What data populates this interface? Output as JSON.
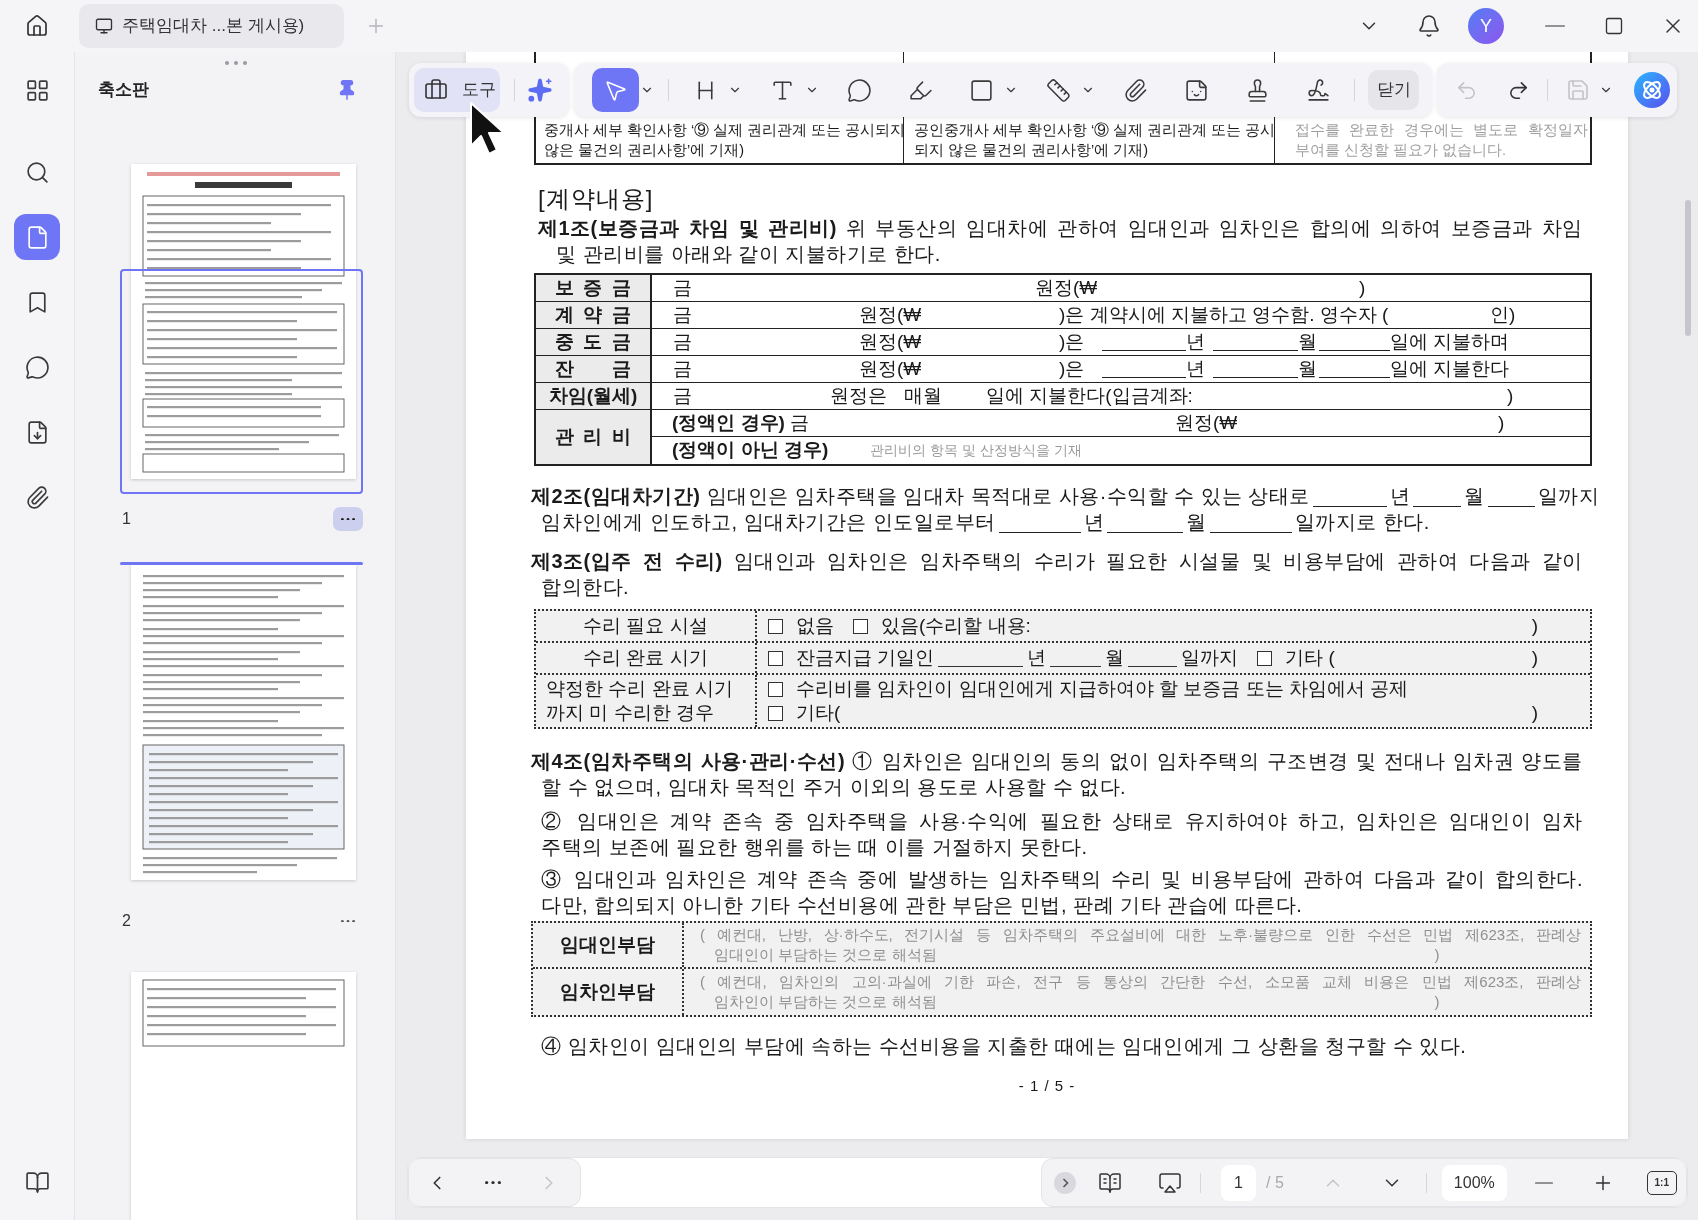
{
  "tab_bar": {
    "tabs": [
      {
        "title": "주택임대차 ...본 게시용)",
        "selected": true
      }
    ],
    "avatar": "Y"
  },
  "sidebar": {
    "items": [
      {
        "selected": false
      },
      {
        "selected": false
      },
      {
        "selected": true
      },
      {
        "selected": false
      },
      {
        "selected": false
      },
      {
        "selected": false
      },
      {
        "selected": false
      }
    ]
  },
  "thumbnails": {
    "title": "축소판",
    "pinned": true,
    "pages": [
      {
        "label": "1",
        "in_view": true,
        "menu_hovered": true
      },
      {
        "label": "2",
        "in_view": true,
        "menu_hovered": false
      }
    ],
    "more_below": true
  },
  "toolbar": {
    "mode_button": {
      "label": "도구",
      "selected": true
    },
    "tools": [
      {
        "selected": true,
        "dropdown": true
      },
      {
        "selected": false,
        "dropdown": true
      },
      {
        "selected": false,
        "dropdown": true
      },
      {
        "selected": false,
        "dropdown": false
      },
      {
        "selected": false,
        "dropdown": false
      },
      {
        "selected": false,
        "dropdown": true
      },
      {
        "selected": false,
        "dropdown": true
      },
      {
        "selected": false,
        "dropdown": false
      },
      {
        "selected": false,
        "dropdown": false
      },
      {
        "selected": false,
        "dropdown": false
      },
      {
        "selected": false,
        "dropdown": false
      }
    ],
    "close_button": "닫기",
    "undo_disabled": true,
    "redo_disabled": false,
    "save_disabled": true
  },
  "document": {
    "blocks": [
      {
        "kind": "fragment_table",
        "columns": [
          {
            "muted": false,
            "lines": [
              "중개사 세부 확인사항 ‘⑨ 실제 권리관계 또는 공시되지",
              "않은 물건의 권리사항’에 기재)"
            ]
          },
          {
            "muted": false,
            "lines": [
              "공인중개사 세부 확인사항 ‘⑨ 실제 권리관계 또는 공시",
              "되지 않은 물건의 권리사항’에 기재)"
            ]
          },
          {
            "muted": true,
            "lines": [
              "접수를 완료한 경우에는 별도로 확정일자",
              "부여를 신청할 필요가 없습니다."
            ]
          }
        ]
      },
      {
        "kind": "heading",
        "text": "[계약내용]"
      },
      {
        "kind": "article",
        "lines": [
          "**제1조(보증금과 차임 및 관리비)** 위 부동산의 임대차에 관하여 임대인과 임차인은 합의에 의하여 보증금과 차임",
          "및 관리비를 아래와 같이 지불하기로 한다."
        ]
      },
      {
        "kind": "payment_table",
        "rows": [
          {
            "label": "보 증 금",
            "kind": "amount",
            "parts": [
              "금",
              "원정(₩",
              ")"
            ]
          },
          {
            "label": "계 약 금",
            "kind": "receipt",
            "parts": [
              "금",
              "원정(₩",
              ")은 계약시에 지불하고 영수함. 영수자 (",
              "인)"
            ]
          },
          {
            "label": "중 도 금",
            "kind": "schedule",
            "parts": [
              "금",
              "원정(₩",
              ")은",
              "년",
              "월",
              "일에 지불하며"
            ]
          },
          {
            "label": "잔 금",
            "kind": "schedule",
            "parts": [
              "금",
              "원정(₩",
              ")은",
              "년",
              "월",
              "일에 지불한다"
            ]
          },
          {
            "label": "차임(월세)",
            "kind": "rent",
            "parts": [
              "금",
              "원정은",
              "매월",
              "일에 지불한다(입금계좌:",
              ")"
            ]
          },
          {
            "label": "관 리 비",
            "kind": "fee",
            "subrows": [
              {
                "kind": "fixed",
                "parts": [
                  "**(정액인 경우)** 금",
                  "원정(₩",
                  ")"
                ]
              },
              {
                "kind": "variable",
                "parts": [
                  "(정액이 아닌 경우)",
                  "관리비의 항목 및 산정방식을 기재"
                ]
              }
            ]
          }
        ]
      },
      {
        "kind": "article",
        "lines": [
          [
            "**제2조(임대차기간)** 임대인은 임차주택을 임대차 목적대로 사용·수익할 수 있는 상태로",
            "년",
            "월",
            "일까지"
          ],
          [
            "임차인에게 인도하고, 임대차기간은 인도일로부터",
            "년",
            "월",
            "일까지로 한다."
          ]
        ]
      },
      {
        "kind": "article",
        "lines": [
          "**제3조(입주 전 수리)** 임대인과 임차인은 임차주택의 수리가 필요한 시설물 및 비용부담에 관하여 다음과 같이",
          "합의한다."
        ]
      },
      {
        "kind": "repair_table",
        "rows": [
          {
            "label": "수리 필요 시설",
            "kind": "inline",
            "options": [
              {
                "checked": false,
                "parts": [
                  "없음"
                ]
              },
              {
                "checked": false,
                "parts": [
                  "있음(수리할 내용:"
                ]
              }
            ],
            "end": ")"
          },
          {
            "label": "수리 완료 시기",
            "kind": "inline",
            "options": [
              {
                "checked": false,
                "parts": [
                  "잔금지급 기일인",
                  "년",
                  "월",
                  "일까지"
                ]
              },
              {
                "checked": false,
                "parts": [
                  "기타 ("
                ]
              }
            ],
            "end": ")"
          },
          {
            "label": "약정한 수리 완료 시기 까지 미 수리한 경우",
            "kind": "stacked",
            "options": [
              {
                "checked": false,
                "parts": [
                  "수리비를 임차인이 임대인에게 지급하여야 할 보증금 또는 차임에서 공제"
                ]
              },
              {
                "checked": false,
                "parts": [
                  "기타("
                ]
              }
            ],
            "end": ")"
          }
        ]
      },
      {
        "kind": "article",
        "lines": [
          "**제4조(임차주택의 사용·관리·수선)** ① 임차인은 임대인의 동의 없이 임차주택의 구조변경 및 전대나 임차권 양도를",
          "할 수 없으며, 임대차 목적인 주거 이외의 용도로 사용할 수 없다."
        ]
      },
      {
        "kind": "clause",
        "lines": [
          "② 임대인은 계약 존속 중 임차주택을 사용·수익에 필요한 상태로 유지하여야 하고, 임차인은 임대인이 임차",
          "주택의 보존에 필요한 행위를 하는 때 이를 거절하지 못한다."
        ]
      },
      {
        "kind": "clause",
        "lines": [
          "③ 임대인과 임차인은 계약 존속 중에 발생하는 임차주택의 수리 및 비용부담에 관하여 다음과 같이 합의한다.",
          "다만, 합의되지 아니한 기타 수선비용에 관한 부담은 민법, 판례 기타 관습에 따른다."
        ]
      },
      {
        "kind": "burden_table",
        "rows": [
          {
            "label": "임대인부담",
            "lines": [
              "( 예컨대, 난방, 상·하수도, 전기시설 등 임차주택의 주요설비에 대한 노후·불량으로 인한 수선은 민법 제623조, 판례상",
              "임대인이 부담하는 것으로 해석됨"
            ],
            "end": ")"
          },
          {
            "label": "임차인부담",
            "lines": [
              "( 예컨대, 임차인의 고의·과실에 기한 파손, 전구 등 통상의 간단한 수선, 소모품 교체 비용은 민법 제623조, 판례상",
              "임차인이 부담하는 것으로 해석됨"
            ],
            "end": ")"
          }
        ]
      },
      {
        "kind": "clause",
        "lines": [
          "④ 임차인이 임대인의 부담에 속하는 수선비용을 지출한 때에는 임대인에게 그 상환을 청구할 수 있다."
        ]
      },
      {
        "kind": "footer",
        "text": "- 1 / 5 -"
      }
    ]
  },
  "status_bar": {
    "previous_disabled": false,
    "next_disabled": true,
    "page": "1",
    "page_total": "/ 5",
    "page_up_disabled": true,
    "page_down_disabled": false,
    "zoom": "100%",
    "actual_size": "1:1"
  }
}
